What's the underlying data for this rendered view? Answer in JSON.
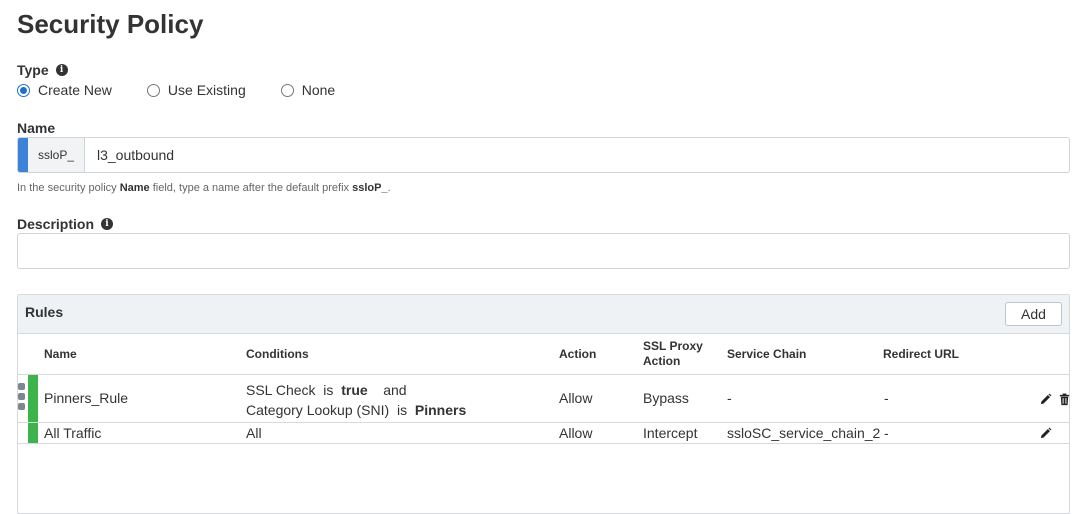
{
  "page": {
    "title": "Security Policy"
  },
  "type_field": {
    "label": "Type",
    "options": [
      {
        "label": "Create New",
        "checked": true
      },
      {
        "label": "Use Existing",
        "checked": false
      },
      {
        "label": "None",
        "checked": false
      }
    ]
  },
  "name_field": {
    "label": "Name",
    "prefix": "ssloP_",
    "value": "l3_outbound",
    "help_pre": "In the security policy ",
    "help_bold1": "Name",
    "help_mid": " field, type a name after the default prefix ",
    "help_bold2": "ssloP_",
    "help_post": "."
  },
  "description_field": {
    "label": "Description",
    "value": ""
  },
  "rules": {
    "title": "Rules",
    "add_label": "Add",
    "columns": {
      "name": "Name",
      "conditions": "Conditions",
      "action": "Action",
      "ssl_proxy_action_1": "SSL Proxy",
      "ssl_proxy_action_2": "Action",
      "service_chain": "Service Chain",
      "redirect_url": "Redirect URL"
    },
    "rows": [
      {
        "name": "Pinners_Rule",
        "cond1_a": "SSL Check",
        "cond1_is": "is",
        "cond1_val": "true",
        "cond1_and": "and",
        "cond2_a": "Category Lookup (SNI)",
        "cond2_is": "is",
        "cond2_val": "Pinners",
        "action": "Allow",
        "ssl_proxy_action": "Bypass",
        "service_chain": "-",
        "redirect_url": "-",
        "status_color": "#3cb44b"
      },
      {
        "name": "All Traffic",
        "conditions": "All",
        "action": "Allow",
        "ssl_proxy_action": "Intercept",
        "service_chain": "ssloSC_service_chain_2",
        "redirect_url": "-",
        "status_color": "#3cb44b"
      }
    ]
  },
  "colors": {
    "accent": "#3a83d8",
    "status_ok": "#3cb44b"
  },
  "icons": [
    "info-icon",
    "pencil-icon",
    "trash-icon",
    "drag-handle-icon"
  ]
}
